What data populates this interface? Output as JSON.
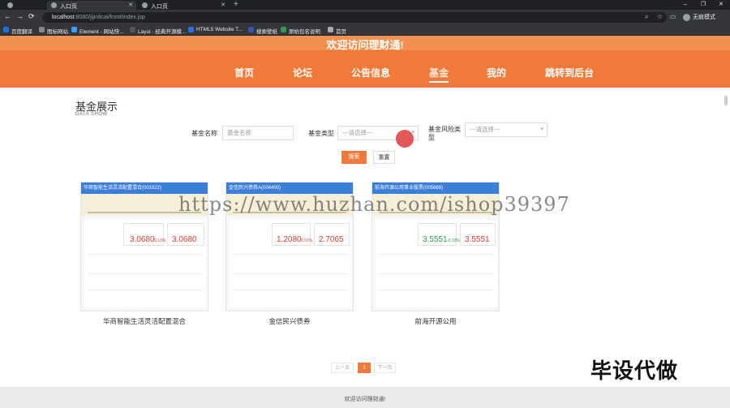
{
  "browser": {
    "tabs": [
      {
        "label": "入口页"
      },
      {
        "label": "入口页"
      }
    ],
    "url_host": "localhost",
    "url_path": ":8080/jijinlicai/front/index.jsp",
    "profile_label": "无痕模式",
    "bookmarks": [
      "百度翻译",
      "图标网站",
      "Element - 网站快...",
      "Layui - 经典开源模...",
      "HTML5 Website T...",
      "搜索壁纸",
      "原始包名说明",
      "首页"
    ]
  },
  "header": {
    "welcome": "欢迎访问理财通!",
    "nav": [
      {
        "label": "首页"
      },
      {
        "label": "论坛"
      },
      {
        "label": "公告信息"
      },
      {
        "label": "基金"
      },
      {
        "label": "我的"
      },
      {
        "label": "跳转到后台"
      }
    ],
    "active_nav": "基金",
    "accent_color": "#f07a3a"
  },
  "section": {
    "title": "基金展示",
    "subtitle": "DATA SHOW"
  },
  "filters": {
    "name_label": "基金名称",
    "name_placeholder": "基金名称",
    "type_label": "基金类型",
    "type_value": "---请选择---",
    "risk_label": "基金风险类型",
    "risk_value": "---请选择---",
    "search_button": "搜索",
    "reset_button": "重置"
  },
  "cards": [
    {
      "head": "华商智能生活灵活配置混合(001822)",
      "val1": "3.0680",
      "pct1": "0.13%",
      "val2": "3.0680",
      "name": "华商智能生活灵活配置混合"
    },
    {
      "head": "金信民兴债券A(004400)",
      "val1": "1.2080",
      "pct1": "0.01%",
      "val2": "2.7065",
      "name": "金信民兴债券"
    },
    {
      "head": "前海开源公用事业股票(005669)",
      "val1": "3.5551",
      "pct1": "-0.33%",
      "val2": "3.5551",
      "name": "前海开源公用"
    }
  ],
  "watermark": "https://www.huzhan.com/ishop39397",
  "pager": {
    "prev": "上一页",
    "current": "1",
    "next": "下一页"
  },
  "brand_mark": "毕设代做",
  "footer": "欢迎访问理财通!"
}
